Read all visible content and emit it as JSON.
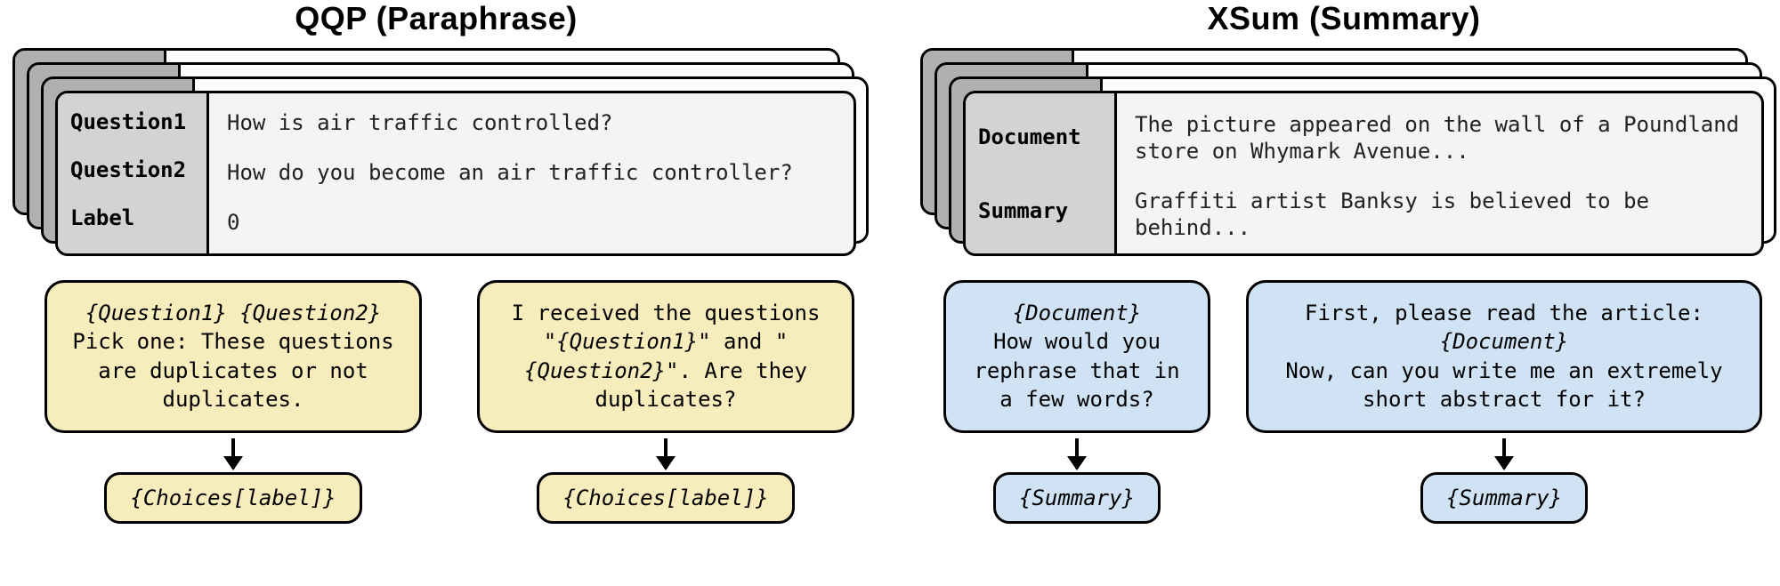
{
  "left": {
    "title": "QQP (Paraphrase)",
    "fields": {
      "q1_label": "Question1",
      "q2_label": "Question2",
      "lab_label": "Label",
      "q1_value": "How is air traffic controlled?",
      "q2_value": "How do you become an air traffic controller?",
      "lab_value": "0"
    },
    "prompts": [
      {
        "text_html": "<span>{Question1} {Question2}</span><br><span class='normal'>Pick one: These questions are duplicates or not duplicates.</span>",
        "output": "{Choices[label]}"
      },
      {
        "text_html": "<span class='normal'>I received the questions </span><span>\"{Question1}\"</span><span class='normal'> and </span><span>\"{Question2}\"</span><span class='normal'>. Are they duplicates?</span>",
        "output": "{Choices[label]}"
      }
    ]
  },
  "right": {
    "title": "XSum (Summary)",
    "fields": {
      "doc_label": "Document",
      "sum_label": "Summary",
      "doc_value": "The picture appeared on the wall of a Poundland store on Whymark Avenue...",
      "sum_value": "Graffiti artist Banksy is believed to be behind..."
    },
    "prompts": [
      {
        "text_html": "<span>{Document}</span><br><span class='normal'>How would you rephrase that in a few words?</span>",
        "output": "{Summary}"
      },
      {
        "text_html": "<span class='normal'>First, please read the article: </span><span>{Document}</span><br><span class='normal'>Now, can you write me an extremely short abstract for it?</span>",
        "output": "{Summary}"
      }
    ]
  }
}
